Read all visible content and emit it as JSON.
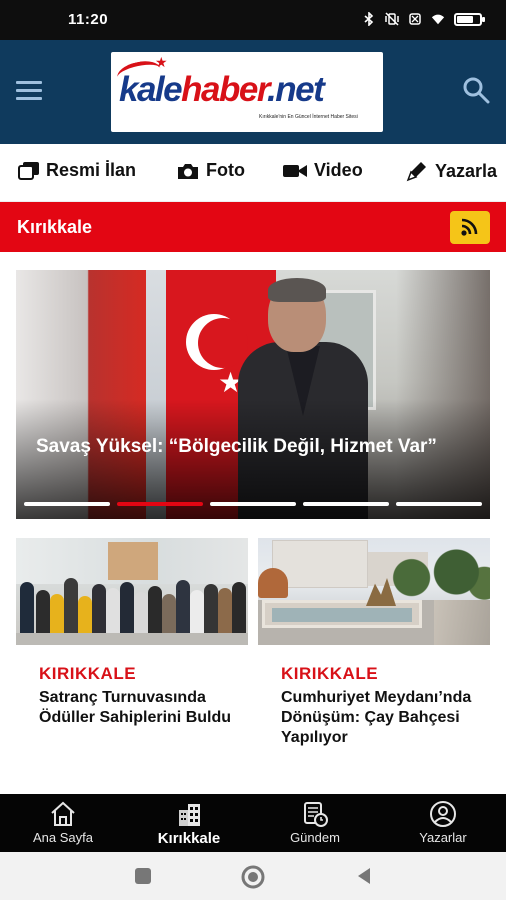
{
  "status_bar": {
    "time": "11:20",
    "icons": [
      "bluetooth-icon",
      "vibrate-off-icon",
      "sim-off-icon",
      "wifi-icon",
      "battery-icon"
    ],
    "battery_level": 0.68
  },
  "header": {
    "logo": {
      "kale": "kale",
      "haber": "haber",
      "net": ".net",
      "tagline": "Kırıkkale'nin En Güncel İnternet Haber Sitesi"
    },
    "menu_icon": "hamburger-menu-icon",
    "search_icon": "search-icon",
    "color": "#0f3a5d"
  },
  "category_nav": {
    "items": [
      {
        "label": "Resmi İlan",
        "icon": "notice-icon"
      },
      {
        "label": "Foto",
        "icon": "camera-icon"
      },
      {
        "label": "Video",
        "icon": "video-camera-icon"
      },
      {
        "label": "Yazarla",
        "icon": "pen-icon"
      }
    ]
  },
  "section": {
    "title": "Kırıkkale",
    "rss_icon": "rss-icon",
    "color": "#e30613",
    "rss_color": "#f5c518"
  },
  "hero": {
    "headline": "Savaş Yüksel: “Bölgecilik Değil, Hizmet Var”",
    "slide_count": 5,
    "active_slide": 2
  },
  "cards": [
    {
      "category": "KIRIKKALE",
      "title": "Satranç Turnuvasında Ödüller Sahiplerini Buldu"
    },
    {
      "category": "KIRIKKALE",
      "title": "Cumhuriyet Meydanı’nda Dönüşüm: Çay Bahçesi Yapılıyor"
    }
  ],
  "bottom_nav": {
    "items": [
      {
        "label": "Ana Sayfa",
        "icon": "home-icon"
      },
      {
        "label": "Kırıkkale",
        "icon": "city-icon",
        "active": true
      },
      {
        "label": "Gündem",
        "icon": "news-clock-icon"
      },
      {
        "label": "Yazarlar",
        "icon": "user-icon"
      }
    ]
  },
  "system_nav": {
    "icons": [
      "recents-icon",
      "home-circle-icon",
      "back-icon"
    ]
  }
}
